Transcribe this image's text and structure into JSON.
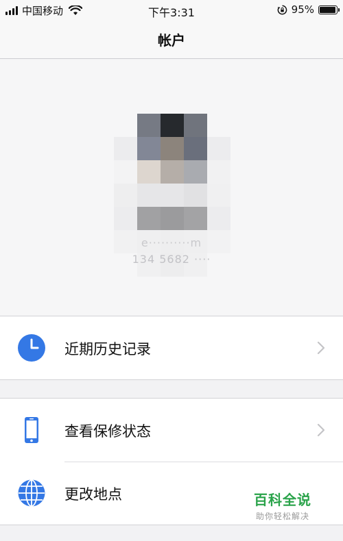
{
  "status_bar": {
    "carrier": "中国移动",
    "time": "下午3:31",
    "battery_percent": "95%",
    "battery_level": 0.95
  },
  "nav": {
    "title": "帐户"
  },
  "profile": {
    "email": "e··········m",
    "phone": "134 5682 ····"
  },
  "menu": {
    "history": {
      "label": "近期历史记录",
      "icon": "clock-icon"
    },
    "warranty": {
      "label": "查看保修状态",
      "icon": "phone-icon"
    },
    "location": {
      "label": "更改地点",
      "icon": "globe-icon"
    }
  },
  "watermark": {
    "title": "百科全说",
    "subtitle": "助你轻松解决"
  },
  "colors": {
    "accent": "#3478e5",
    "watermark_green": "#2aa34a"
  }
}
